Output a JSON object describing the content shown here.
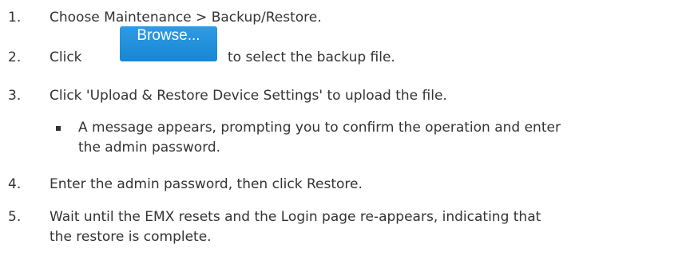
{
  "steps": [
    {
      "number": "1.",
      "text": "Choose Maintenance > Backup/Restore."
    },
    {
      "number": "2.",
      "text_before": "Click",
      "button_label": "Browse...",
      "text_after": "to select the backup file."
    },
    {
      "number": "3.",
      "text": "Click 'Upload & Restore Device Settings' to upload the file."
    },
    {
      "bullet_line1": "A message appears, prompting you to confirm the operation and enter",
      "bullet_line2": "the admin password."
    },
    {
      "number": "4.",
      "text": "Enter the admin password, then click Restore."
    },
    {
      "number": "5.",
      "line1": "Wait until the EMX resets and the Login page re-appears, indicating that",
      "line2": "the restore is complete."
    }
  ],
  "colors": {
    "text": "#333333",
    "button": "#1e8fdc",
    "button_text": "#ffffff"
  }
}
